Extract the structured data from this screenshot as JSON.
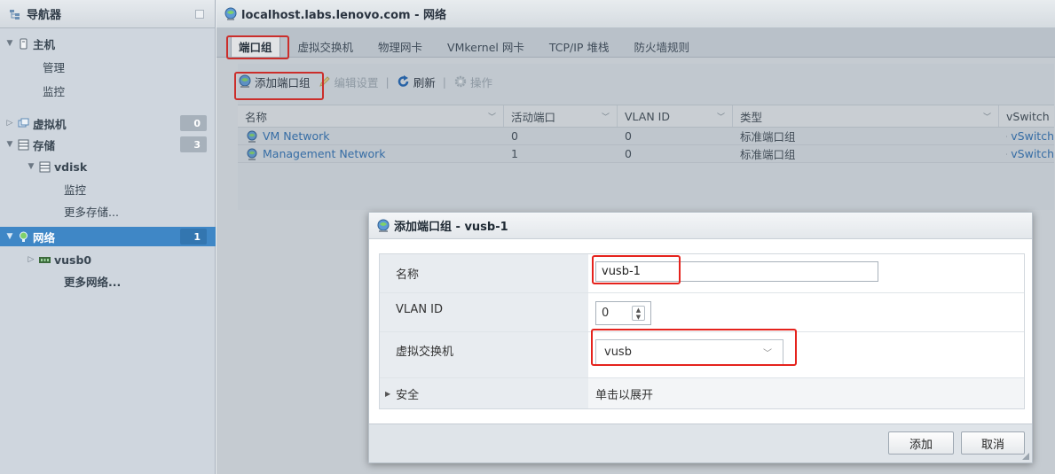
{
  "colors": {
    "accent": "#3f87c6",
    "highlight_red": "#e5231d",
    "link": "#2f6fb1"
  },
  "navigator": {
    "title": "导航器",
    "items": [
      {
        "label": "主机",
        "icon": "host-icon"
      },
      {
        "label": "管理"
      },
      {
        "label": "监控"
      },
      {
        "label": "虚拟机",
        "count": "0",
        "icon": "vm-icon"
      },
      {
        "label": "存储",
        "count": "3",
        "icon": "storage-icon"
      },
      {
        "label": "vdisk",
        "icon": "datastore-icon"
      },
      {
        "label": "监控"
      },
      {
        "label": "更多存储..."
      },
      {
        "label": "网络",
        "count": "1",
        "icon": "network-icon"
      },
      {
        "label": "vusb0",
        "icon": "nic-icon"
      },
      {
        "label": "更多网络..."
      }
    ]
  },
  "header": {
    "title": "localhost.labs.lenovo.com - 网络"
  },
  "tabs": [
    {
      "label": "端口组"
    },
    {
      "label": "虚拟交换机"
    },
    {
      "label": "物理网卡"
    },
    {
      "label": "VMkernel 网卡"
    },
    {
      "label": "TCP/IP 堆栈"
    },
    {
      "label": "防火墙规则"
    }
  ],
  "toolbar": {
    "add_port_group": "添加端口组",
    "edit_settings": "编辑设置",
    "refresh": "刷新",
    "actions": "操作"
  },
  "table": {
    "columns": [
      "名称",
      "活动端口",
      "VLAN ID",
      "类型",
      "vSwitch"
    ],
    "rows": [
      {
        "name": "VM Network",
        "active_ports": "0",
        "vlan": "0",
        "type": "标准端口组",
        "vswitch": "vSwitch"
      },
      {
        "name": "Management Network",
        "active_ports": "1",
        "vlan": "0",
        "type": "标准端口组",
        "vswitch": "vSwitch"
      }
    ]
  },
  "dialog": {
    "title": "添加端口组 - vusb-1",
    "fields": {
      "name_label": "名称",
      "name_value": "vusb-1",
      "vlan_label": "VLAN ID",
      "vlan_value": "0",
      "vswitch_label": "虚拟交换机",
      "vswitch_value": "vusb",
      "security_label": "安全",
      "security_value": "单击以展开"
    },
    "add_button": "添加",
    "cancel_button": "取消"
  }
}
